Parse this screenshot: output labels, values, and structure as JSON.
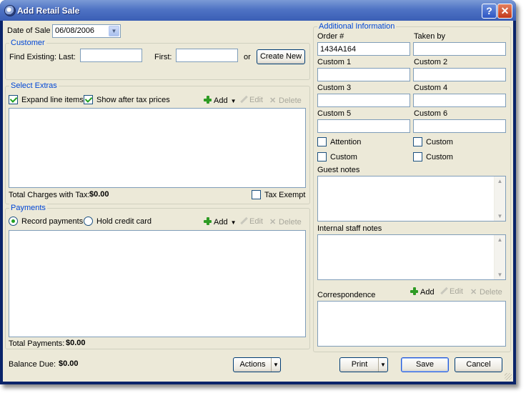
{
  "window": {
    "title": "Add Retail Sale",
    "help_label": "?",
    "close_label": "✕"
  },
  "date": {
    "label": "Date of Sale",
    "value": "06/08/2006"
  },
  "customer": {
    "legend": "Customer",
    "find_label": "Find Existing:",
    "last_label": "Last:",
    "last_value": "",
    "first_label": "First:",
    "first_value": "",
    "or_label": "or",
    "create_label": "Create New"
  },
  "extras": {
    "legend": "Select Extras",
    "expand_label": "Expand line items",
    "expand_checked": true,
    "after_tax_label": "Show after tax prices",
    "after_tax_checked": true,
    "add_label": "Add",
    "edit_label": "Edit",
    "delete_label": "Delete",
    "total_label": "Total Charges with Tax:",
    "total_value": "$0.00",
    "tax_exempt_label": "Tax Exempt",
    "tax_exempt_checked": false
  },
  "payments": {
    "legend": "Payments",
    "record_label": "Record payments",
    "hold_label": "Hold credit card",
    "add_label": "Add",
    "edit_label": "Edit",
    "delete_label": "Delete",
    "total_label": "Total Payments:",
    "total_value": "$0.00"
  },
  "balance": {
    "label": "Balance Due:",
    "value": "$0.00"
  },
  "additional": {
    "legend": "Additional Information",
    "order_label": "Order #",
    "order_value": "1434A164",
    "taken_label": "Taken by",
    "taken_value": "",
    "custom1_label": "Custom 1",
    "custom2_label": "Custom 2",
    "custom3_label": "Custom 3",
    "custom4_label": "Custom 4",
    "custom5_label": "Custom 5",
    "custom6_label": "Custom 6",
    "attention_label": "Attention",
    "custom_chk1_label": "Custom",
    "custom_chk2_label": "Custom",
    "custom_chk3_label": "Custom",
    "guest_notes_label": "Guest notes",
    "staff_notes_label": "Internal staff notes",
    "correspondence_label": "Correspondence",
    "add_label": "Add",
    "edit_label": "Edit",
    "delete_label": "Delete"
  },
  "footer": {
    "actions_label": "Actions",
    "print_label": "Print",
    "save_label": "Save",
    "cancel_label": "Cancel"
  },
  "icons": {
    "add": "plus-icon",
    "edit": "pencil-icon",
    "delete": "x-icon"
  }
}
